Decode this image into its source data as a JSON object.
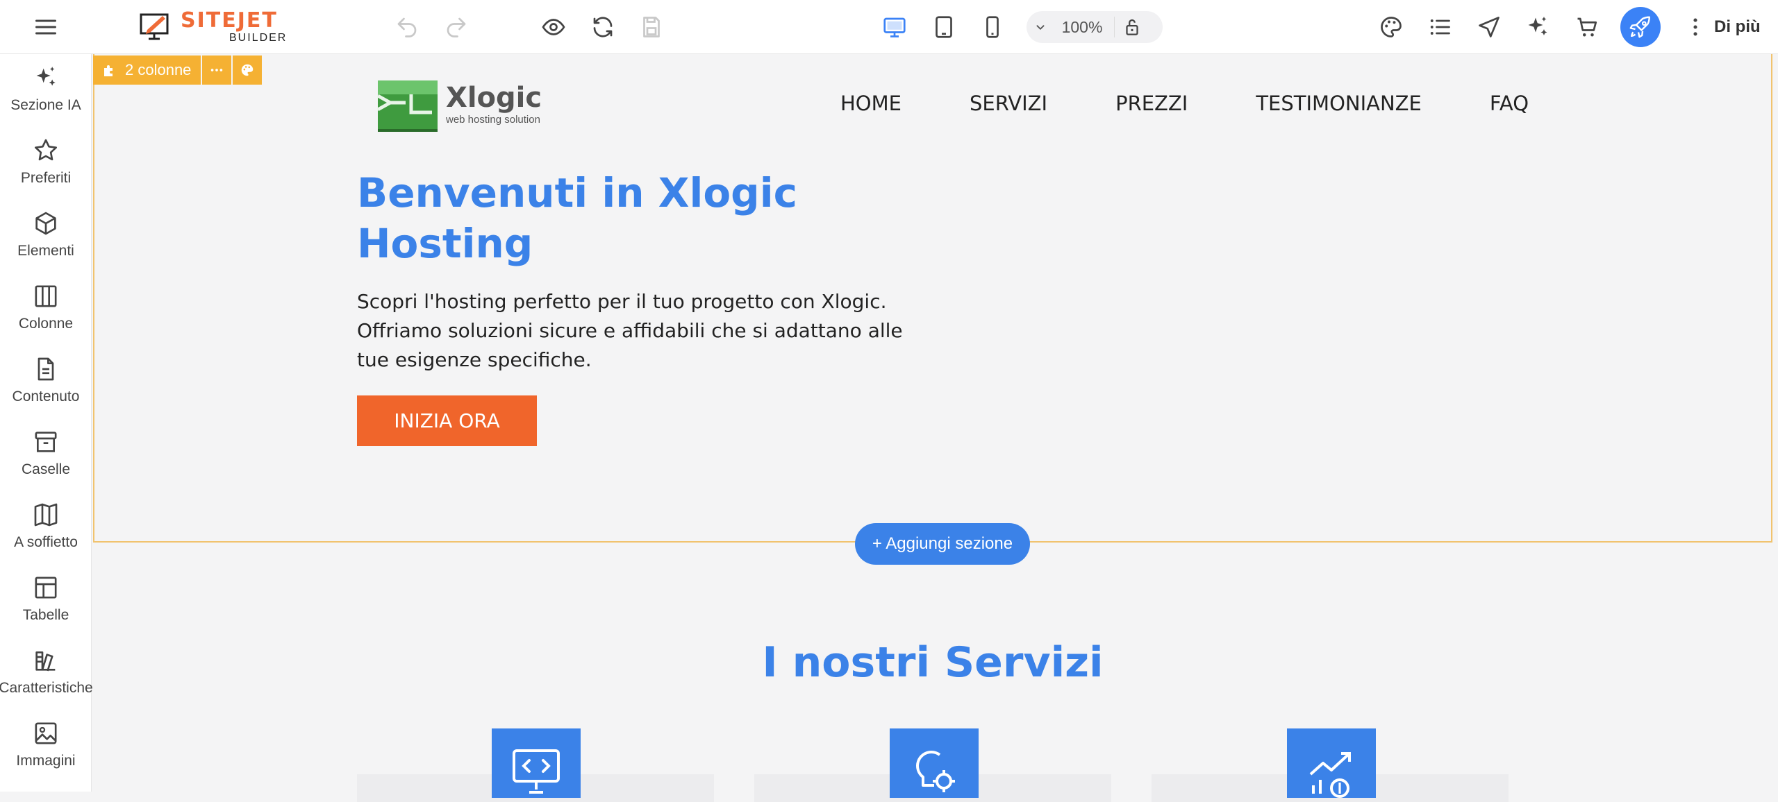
{
  "app": {
    "logo_main": "SITEJET",
    "logo_sub": "BUILDER",
    "zoom": "100%",
    "more_label": "Di più",
    "accent": "#3b82f6",
    "brand_orange": "#ef6b37"
  },
  "toolbar_icons": [
    "menu-icon",
    "undo-icon",
    "redo-icon",
    "preview-eye-icon",
    "refresh-icon",
    "save-icon",
    "desktop-icon",
    "tablet-icon",
    "mobile-icon",
    "chevron-down-icon",
    "lock-icon",
    "palette-icon",
    "list-icon",
    "navigation-icon",
    "ai-sparkle-icon",
    "cart-icon",
    "rocket-icon",
    "more-vertical-icon"
  ],
  "sidebar": {
    "items": [
      {
        "label": "Sezione IA",
        "icon": "sparkle-icon"
      },
      {
        "label": "Preferiti",
        "icon": "star-icon"
      },
      {
        "label": "Elementi",
        "icon": "cube-icon"
      },
      {
        "label": "Colonne",
        "icon": "columns-icon"
      },
      {
        "label": "Contenuto",
        "icon": "document-icon"
      },
      {
        "label": "Caselle",
        "icon": "box-icon"
      },
      {
        "label": "A soffietto",
        "icon": "accordion-icon"
      },
      {
        "label": "Tabelle",
        "icon": "table-icon"
      },
      {
        "label": "Caratteristiche",
        "icon": "features-icon"
      },
      {
        "label": "Immagini",
        "icon": "image-icon"
      }
    ]
  },
  "section_toolbar": {
    "label": "2 colonne",
    "section_color": "#f5b133"
  },
  "site": {
    "brand_name": "Xlogic",
    "brand_tagline": "web hosting solution",
    "nav": [
      "HOME",
      "SERVIZI",
      "PREZZI",
      "TESTIMONIANZE",
      "FAQ"
    ],
    "hero_title": "Benvenuti in Xlogic Hosting",
    "hero_text": "Scopri l'hosting perfetto per il tuo progetto con Xlogic. Offriamo soluzioni sicure e affidabili che si adattano alle tue esigenze specifiche.",
    "cta_label": "INIZIA ORA",
    "cta_color": "#f0652b",
    "heading_color": "#3b82e8",
    "add_section_label": "+ Aggiungi sezione",
    "services_title": "I nostri Servizi",
    "service_icons": [
      "code-monitor-icon",
      "idea-gear-icon",
      "growth-chart-icon"
    ]
  }
}
